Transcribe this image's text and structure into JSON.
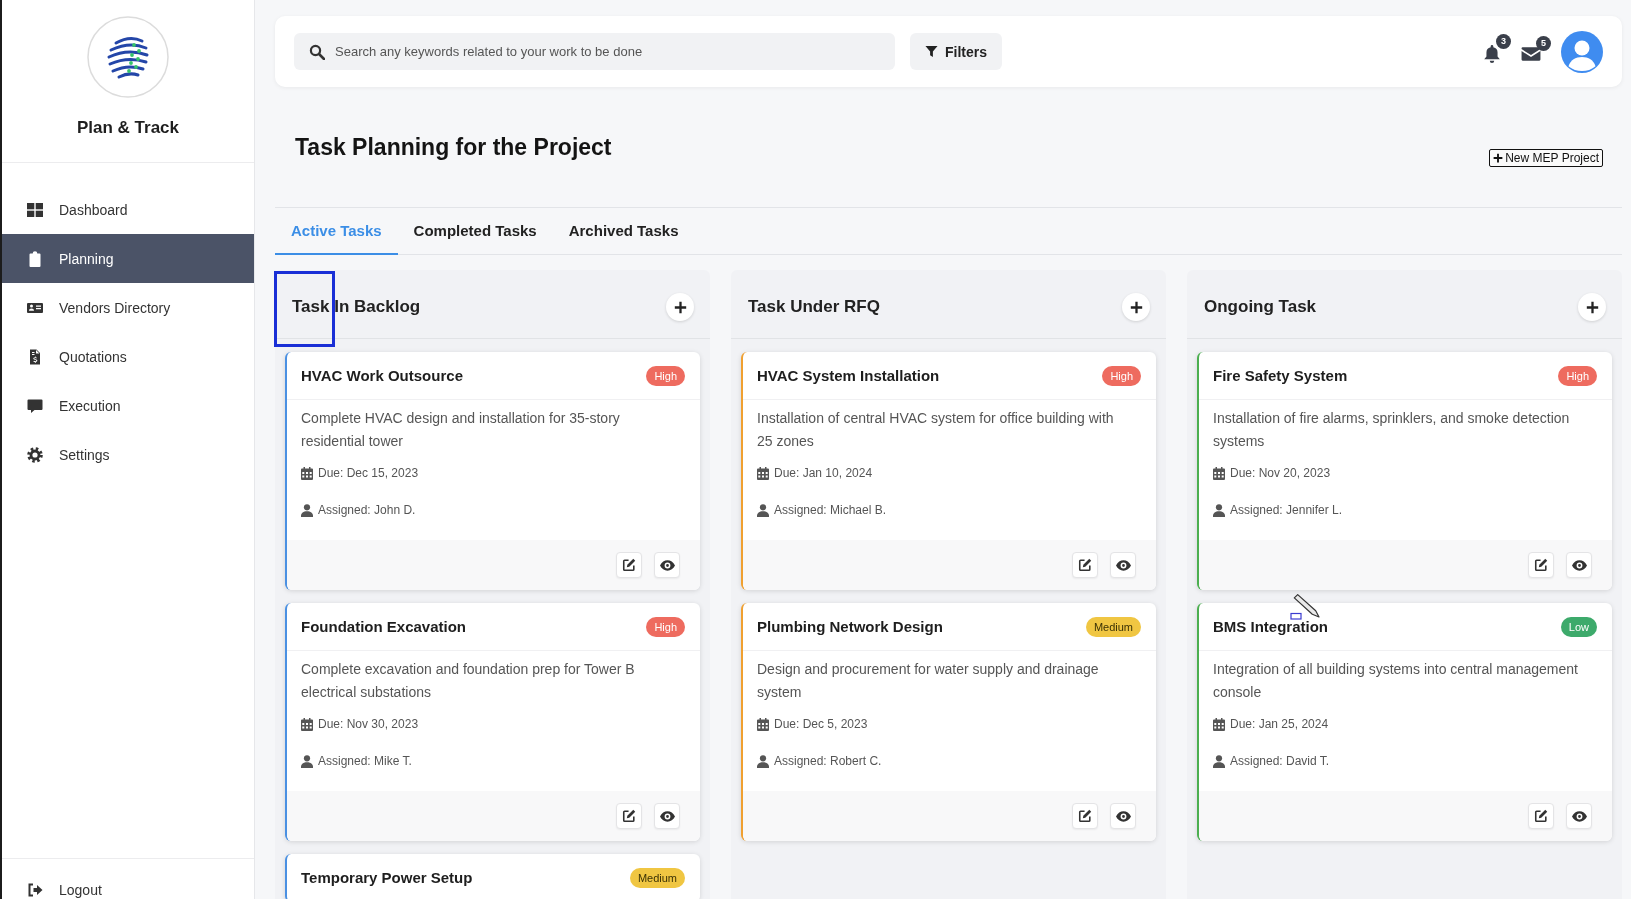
{
  "sidebar": {
    "brand": "Plan & Track",
    "items": [
      {
        "label": "Dashboard",
        "selected": false
      },
      {
        "label": "Planning",
        "selected": true
      },
      {
        "label": "Vendors Directory",
        "selected": false
      },
      {
        "label": "Quotations",
        "selected": false
      },
      {
        "label": "Execution",
        "selected": false
      },
      {
        "label": "Settings",
        "selected": false
      }
    ],
    "logout": "Logout"
  },
  "header": {
    "search": {
      "placeholder": "Search any keywords related to your work to be done"
    },
    "filters_button": "Filters",
    "notifications": {
      "count": "3"
    },
    "messages": {
      "count": "5"
    }
  },
  "page": {
    "title": "Task Planning for the Project",
    "new_button": "New MEP Project"
  },
  "tabs": [
    {
      "label": "Active Tasks",
      "selected": true
    },
    {
      "label": "Completed Tasks",
      "selected": false
    },
    {
      "label": "Archived Tasks",
      "selected": false
    }
  ],
  "columns": [
    {
      "title": "Task In Backlog",
      "framed": true,
      "color": "#4a90e2",
      "cards": [
        {
          "title": "HVAC Work Outsource",
          "badge": {
            "label": "High",
            "color": "#ee6b5f"
          },
          "description": "Complete HVAC design and installation for 35-story residential tower",
          "due": "Due: Dec 15, 2023",
          "assigned": "Assigned: John D."
        },
        {
          "title": "Foundation Excavation",
          "badge": {
            "label": "High",
            "color": "#ee6b5f"
          },
          "description": "Complete excavation and foundation prep for Tower B electrical substations",
          "due": "Due: Nov 30, 2023",
          "assigned": "Assigned: Mike T."
        },
        {
          "title": "Temporary Power Setup",
          "badge": {
            "label": "Medium",
            "color": "#f0c642"
          }
        }
      ]
    },
    {
      "title": "Task Under RFQ",
      "framed": false,
      "color": "#f0a030",
      "cards": [
        {
          "title": "HVAC System Installation",
          "badge": {
            "label": "High",
            "color": "#ee6b5f"
          },
          "description": "Installation of central HVAC system for office building with 25 zones",
          "due": "Due: Jan 10, 2024",
          "assigned": "Assigned: Michael B."
        },
        {
          "title": "Plumbing Network Design",
          "badge": {
            "label": "Medium",
            "color": "#f0c642"
          },
          "description": "Design and procurement for water supply and drainage system",
          "due": "Due: Dec 5, 2023",
          "assigned": "Assigned: Robert C."
        }
      ]
    },
    {
      "title": "Ongoing Task",
      "framed": false,
      "color": "#4caf50",
      "cards": [
        {
          "title": "Fire Safety System",
          "badge": {
            "label": "High",
            "color": "#ee6b5f"
          },
          "description": "Installation of fire alarms, sprinklers, and smoke detection systems",
          "due": "Due: Nov 20, 2023",
          "assigned": "Assigned: Jennifer L."
        },
        {
          "title": "BMS Integration",
          "badge": {
            "label": "Low",
            "color": "#3daa6b"
          },
          "description": "Integration of all building systems into central management console",
          "due": "Due: Jan 25, 2024",
          "assigned": "Assigned: David T."
        }
      ]
    }
  ]
}
